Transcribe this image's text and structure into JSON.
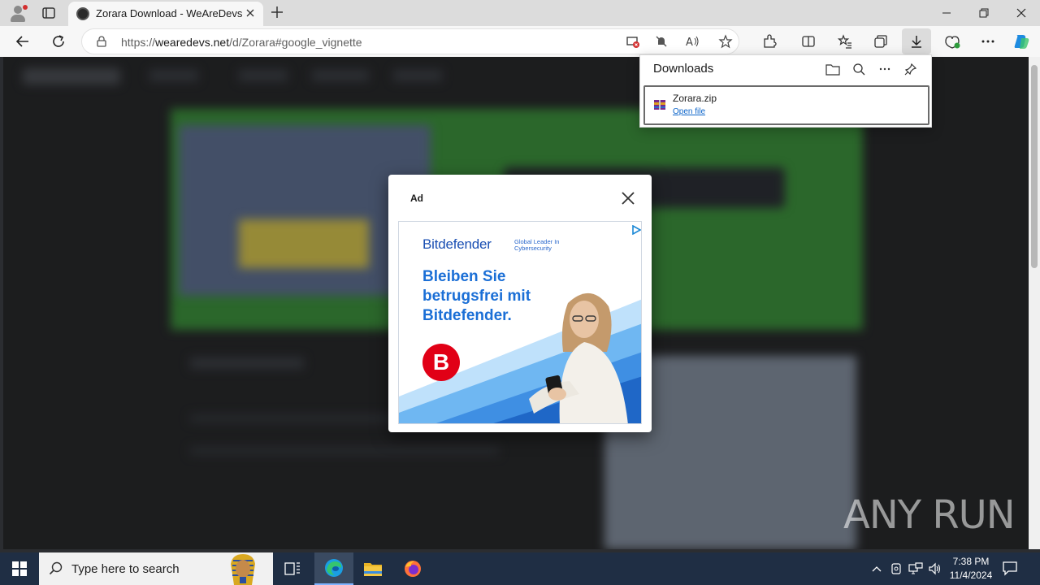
{
  "browser": {
    "tab_title": "Zorara Download - WeAreDevs",
    "url_prefix": "https://",
    "url_domain": "wearedevs.net",
    "url_path": "/d/Zorara#google_vignette"
  },
  "downloads": {
    "title": "Downloads",
    "item_name": "Zorara.zip",
    "item_action": "Open file"
  },
  "ad": {
    "label": "Ad",
    "brand": "Bitdefender",
    "tagline": "Global Leader In Cybersecurity",
    "headline": "Bleiben Sie betrugsfrei mit Bitdefender.",
    "logo_letter": "B"
  },
  "taskbar": {
    "search_placeholder": "Type here to search",
    "time": "7:38 PM",
    "date": "11/4/2024"
  },
  "watermark": "ANY RUN",
  "colors": {
    "accent": "#1b6fd6",
    "brand_red": "#e10016",
    "taskbar": "#1f2e44"
  }
}
